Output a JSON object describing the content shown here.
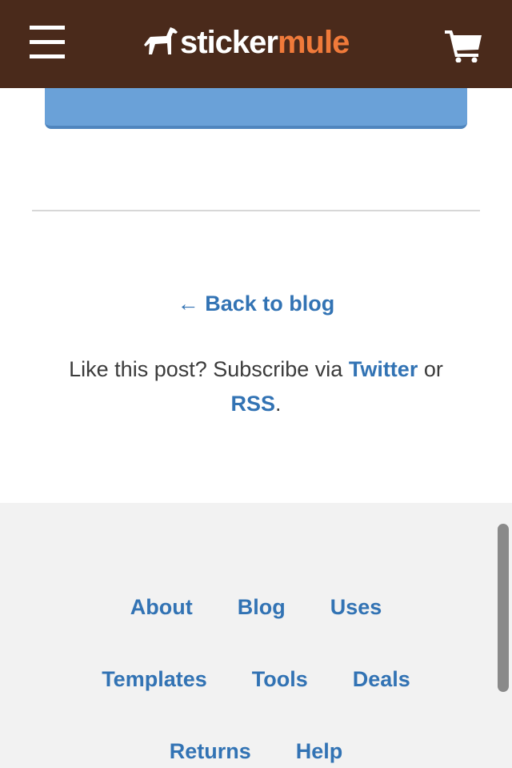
{
  "header": {
    "brand_first": "sticker",
    "brand_second": "mule",
    "menu_icon": "hamburger-menu-icon",
    "cart_icon": "shopping-cart-icon",
    "colors": {
      "background": "#4a2a1b",
      "brand_accent": "#f07a3a"
    }
  },
  "post_nav": {
    "back_link": "← Back to blog",
    "subscribe_prefix": "Like this post? Subscribe via ",
    "twitter_label": "Twitter",
    "subscribe_or": " or ",
    "rss_label": "RSS",
    "subscribe_suffix": "."
  },
  "footer": {
    "links": [
      "About",
      "Blog",
      "Uses",
      "Templates",
      "Tools",
      "Deals",
      "Returns",
      "Help"
    ],
    "link_color": "#3273b4"
  }
}
